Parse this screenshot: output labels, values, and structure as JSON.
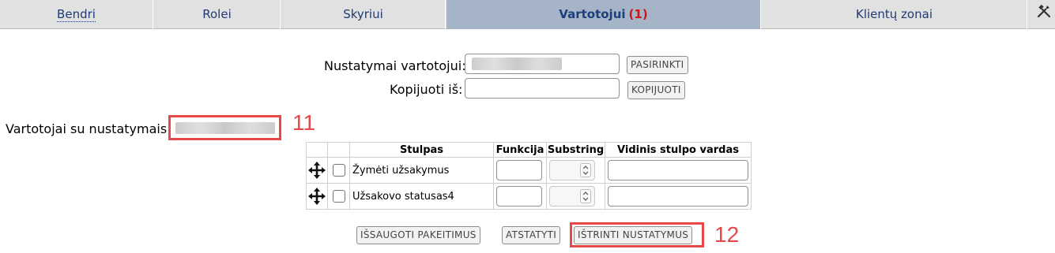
{
  "tabs": [
    {
      "label": "Bendri",
      "active": false
    },
    {
      "label": "Rolei",
      "active": false
    },
    {
      "label": "Skyriui",
      "active": false
    },
    {
      "label": "Vartotojui",
      "count": "(1)",
      "active": true
    },
    {
      "label": "Klientų zonai",
      "active": false
    }
  ],
  "form": {
    "settings_for_user_label": "Nustatymai vartotojui:",
    "choose_button": "PASIRINKTI",
    "copy_from_label": "Kopijuoti iš:",
    "copy_button": "KOPIJUOTI",
    "users_with_settings_label": "Vartotojai su nustatymais:"
  },
  "table": {
    "headers": [
      "Stulpas",
      "Funkcija",
      "Substring",
      "Vidinis stulpo vardas"
    ],
    "rows": [
      {
        "name": "Žymėti užsakymus"
      },
      {
        "name": "Užsakovo statusas4"
      }
    ]
  },
  "actions": {
    "save_button": "IŠSAUGOTI PAKEITIMUS",
    "restore_button": "ATSTATYTI",
    "delete_button": "IŠTRINTI NUSTATYMUS"
  },
  "annotations": {
    "callout_1": "11",
    "callout_2": "12",
    "color": "#e84848"
  },
  "icons": {
    "tools": "tools-icon",
    "move": "move-arrows-icon"
  }
}
